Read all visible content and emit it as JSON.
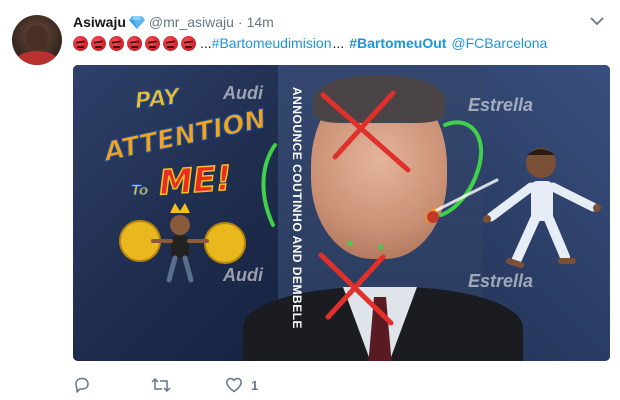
{
  "tweet": {
    "display_name": "Asiwaju",
    "handle": "@mr_asiwaju",
    "separator": "·",
    "time": "14m",
    "emoji_count": 7,
    "ellipsis": "...",
    "hashtag_1": "#Bartomeudimision",
    "ellipsis_2": "...",
    "hashtag_2": "#BartomeuOut",
    "mention": "@FCBarcelona",
    "icons": {
      "verified": "diamond-icon",
      "caret": "chevron-down-icon",
      "emoji": "angry-face-icon",
      "reply": "reply-icon",
      "retweet": "retweet-icon",
      "like": "heart-icon"
    },
    "colors": {
      "link": "#1b95e0",
      "muted": "#657786",
      "text": "#14171a",
      "verified": "#5bb7ef"
    }
  },
  "media": {
    "sticker_pay": "PAY",
    "sticker_attention": "ATTENTION",
    "sticker_to": "To",
    "sticker_me": "ME!",
    "caption": "ANNOUNCE COUTINHO AND DEMBELE",
    "sponsor_1": "Estrella",
    "sponsor_2": "Estrella",
    "sponsor_3": "Audi",
    "sponsor_4": "Audi"
  },
  "actions": {
    "like_count": "1"
  }
}
